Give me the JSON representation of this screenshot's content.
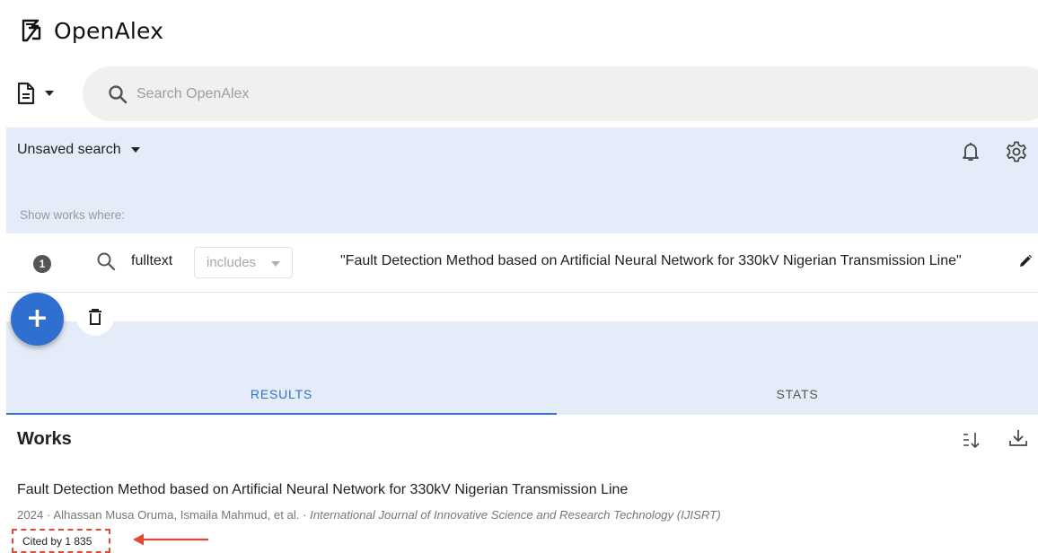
{
  "app": {
    "name": "OpenAlex"
  },
  "search": {
    "placeholder": "Search OpenAlex",
    "value": ""
  },
  "panel": {
    "saved_search_label": "Unsaved search",
    "show_works_where": "Show works where:"
  },
  "filter": {
    "number": "1",
    "field": "fulltext",
    "operator": "includes",
    "value": "\"Fault Detection Method based on Artificial Neural Network for 330kV Nigerian Transmission Line\""
  },
  "tabs": [
    {
      "label": "RESULTS",
      "active": true
    },
    {
      "label": "STATS",
      "active": false
    }
  ],
  "works": {
    "heading": "Works",
    "results": [
      {
        "title": "Fault Detection Method based on Artificial Neural Network for 330kV Nigerian Transmission Line",
        "meta_prefix": "2024 · Alhassan Musa Oruma, Ismaila Mahmud, et al. · ",
        "venue": "International Journal of Innovative Science and Research Technology (IJISRT)",
        "cited_by": "Cited by 1 835"
      }
    ]
  },
  "colors": {
    "accent": "#3472c6",
    "fab": "#2f6fd0",
    "panel_bg": "#e3ecf8",
    "annotation": "#e14a35"
  },
  "icons": [
    "openalex-logo-icon",
    "document-icon",
    "caret-down-icon",
    "search-icon",
    "bell-icon",
    "gear-icon",
    "pencil-icon",
    "plus-icon",
    "trash-icon",
    "sort-icon",
    "download-icon",
    "arrow-left-icon"
  ]
}
